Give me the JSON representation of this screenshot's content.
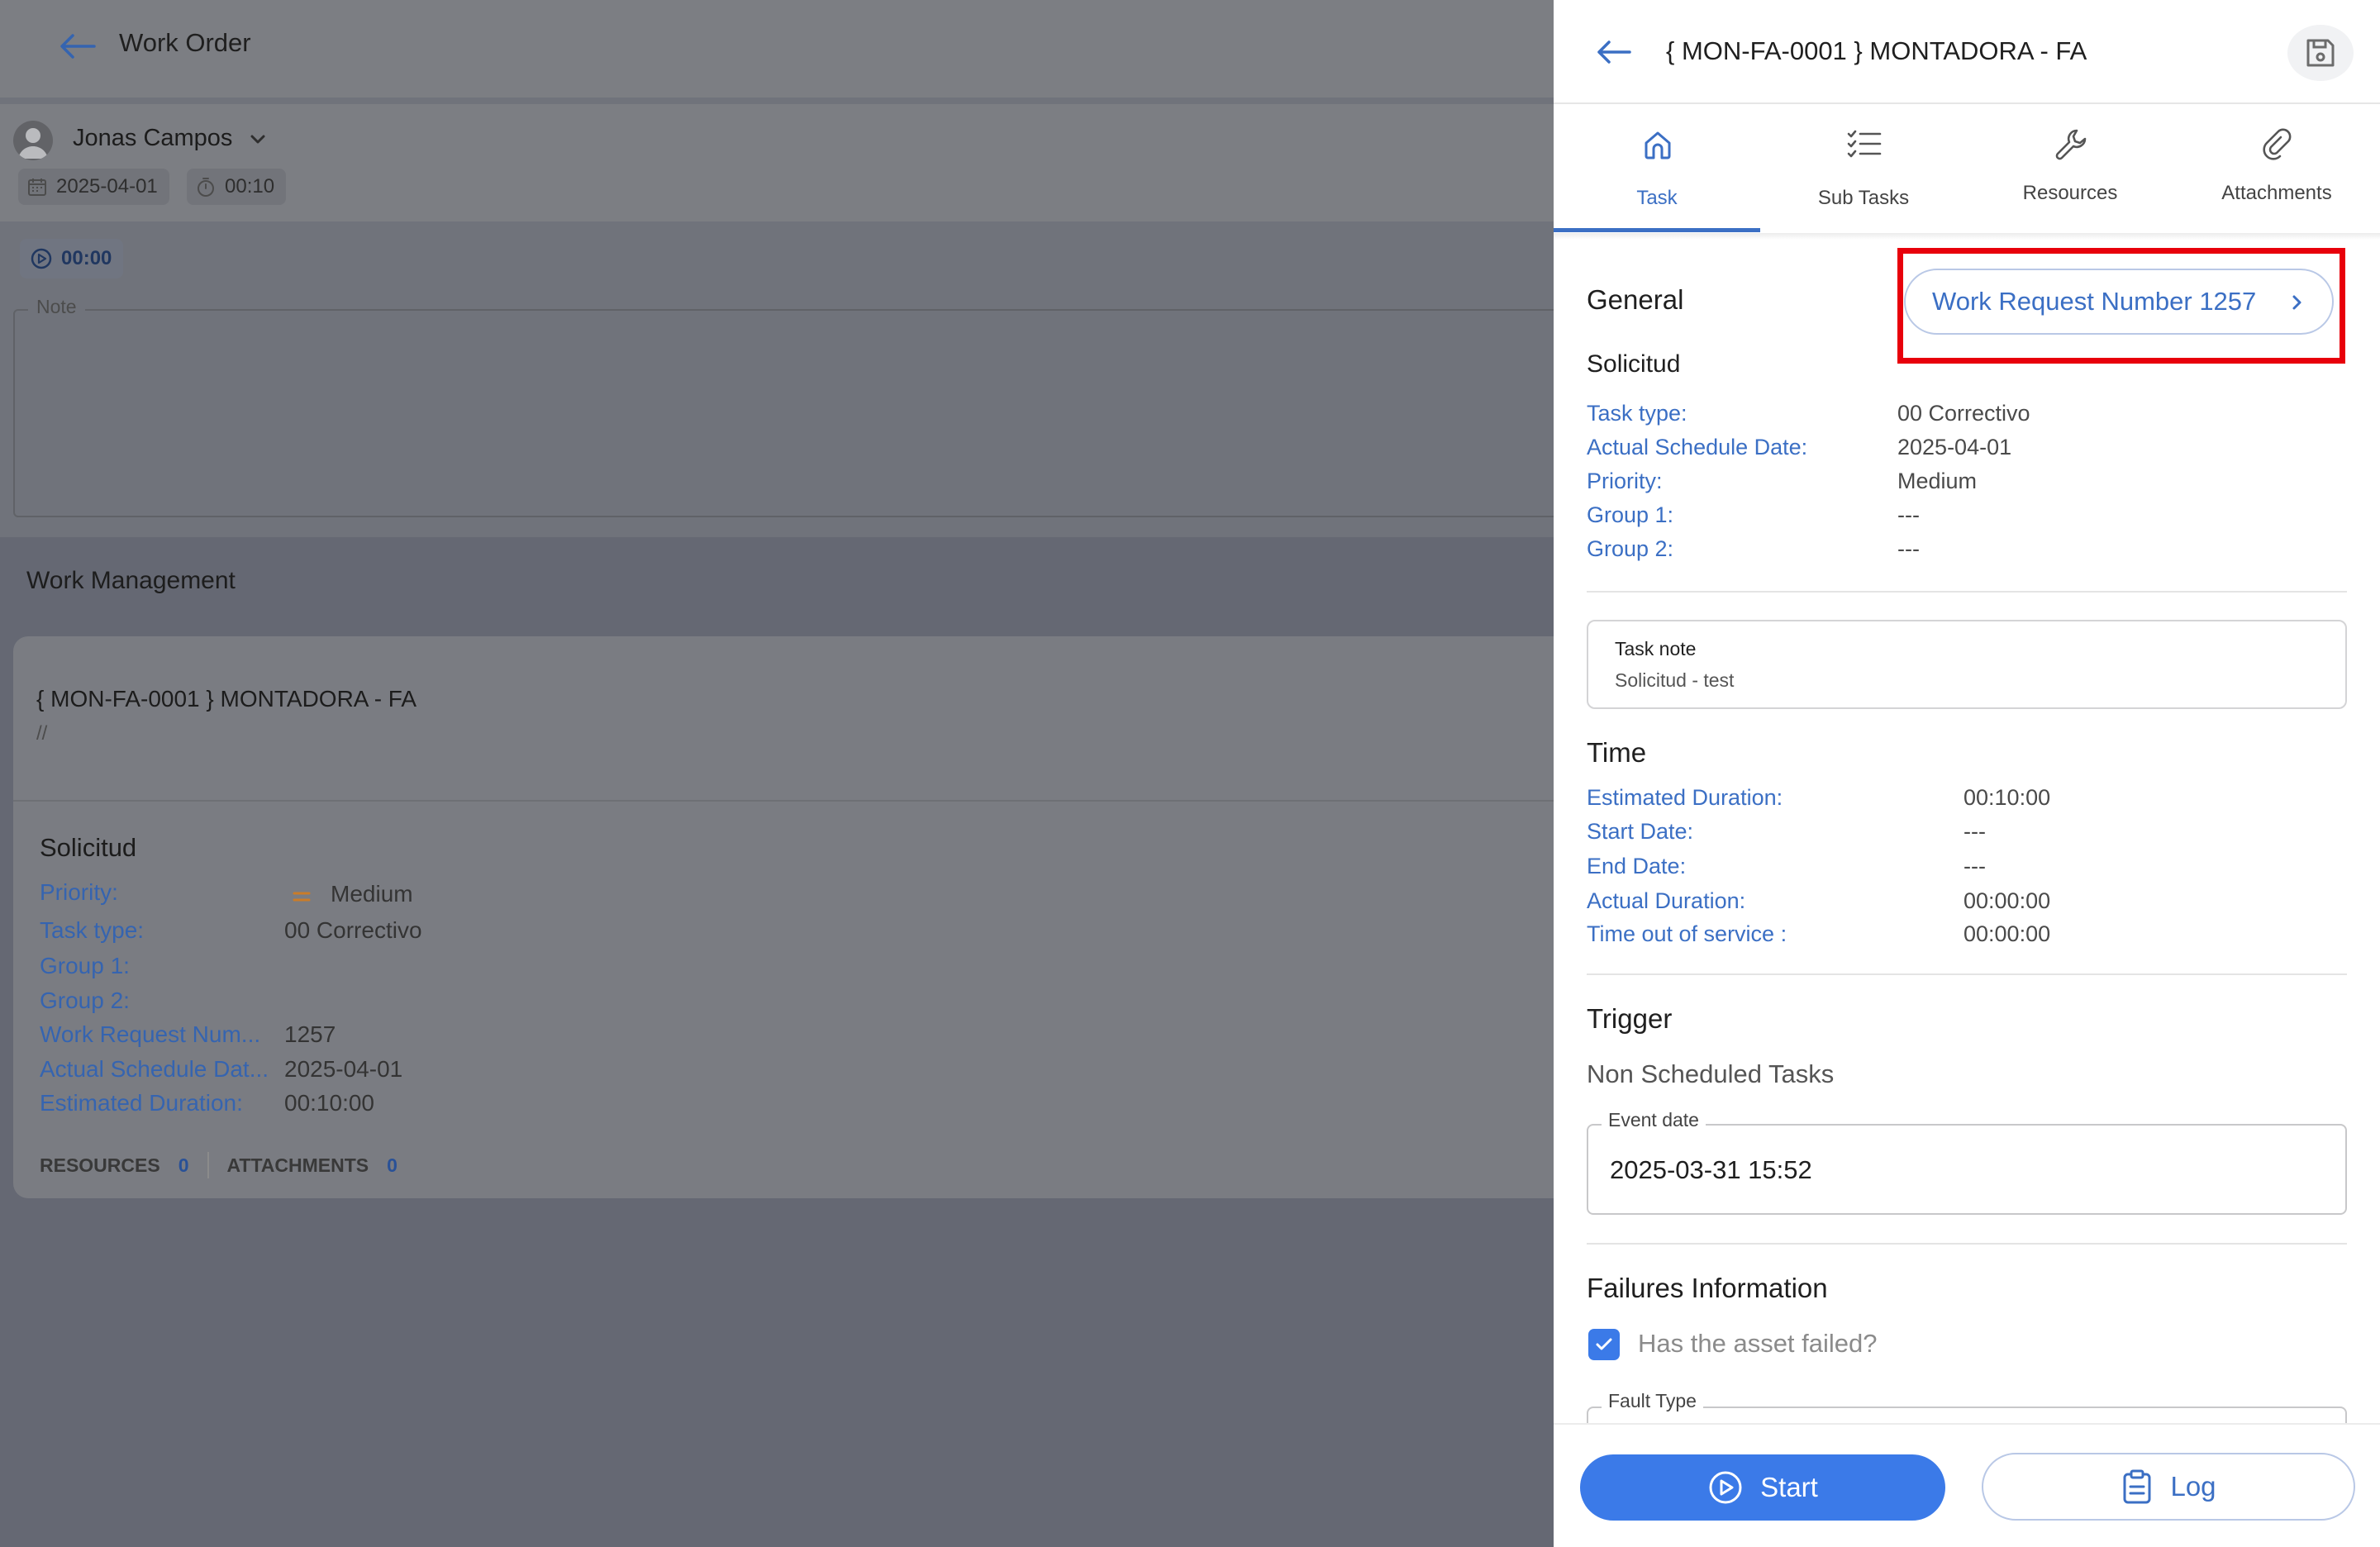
{
  "page": {
    "title": "Work Order",
    "user": {
      "name": "Jonas Campos"
    },
    "date": "2025-04-01",
    "timer": "00:10",
    "play_time": "00:00",
    "note_label": "Note"
  },
  "work_management": {
    "title": "Work Management",
    "card": {
      "asset": "{ MON-FA-0001 } MONTADORA - FA",
      "path": "//",
      "section": "Solicitud",
      "rows": [
        {
          "label": "Priority:",
          "value": "Medium"
        },
        {
          "label": "Task type:",
          "value": "00 Correctivo"
        },
        {
          "label": "Group 1:",
          "value": ""
        },
        {
          "label": "Group 2:",
          "value": ""
        },
        {
          "label": "Work Request Num...",
          "value": "1257"
        },
        {
          "label": "Actual Schedule Dat...",
          "value": "2025-04-01"
        },
        {
          "label": "Estimated Duration:",
          "value": "00:10:00"
        }
      ],
      "resources_label": "RESOURCES",
      "resources_count": "0",
      "attachments_label": "ATTACHMENTS",
      "attachments_count": "0"
    }
  },
  "drawer": {
    "title": "{ MON-FA-0001 } MONTADORA - FA",
    "tabs": [
      {
        "label": "Task",
        "icon": "home-icon",
        "active": true
      },
      {
        "label": "Sub Tasks",
        "icon": "checklist-icon",
        "active": false
      },
      {
        "label": "Resources",
        "icon": "wrench-icon",
        "active": false
      },
      {
        "label": "Attachments",
        "icon": "paperclip-icon",
        "active": false
      }
    ],
    "general": {
      "title": "General",
      "work_request_button": "Work Request Number 1257",
      "section": "Solicitud",
      "rows": [
        {
          "label": "Task type:",
          "value": "00 Correctivo"
        },
        {
          "label": "Actual Schedule Date:",
          "value": "2025-04-01"
        },
        {
          "label": "Priority:",
          "value": "Medium"
        },
        {
          "label": "Group 1:",
          "value": "---"
        },
        {
          "label": "Group 2:",
          "value": "---"
        }
      ],
      "task_note_label": "Task note",
      "task_note_value": "Solicitud - test"
    },
    "time": {
      "title": "Time",
      "rows": [
        {
          "label": "Estimated Duration:",
          "value": "00:10:00"
        },
        {
          "label": "Start Date:",
          "value": "---"
        },
        {
          "label": "End Date:",
          "value": "---"
        },
        {
          "label": "Actual Duration:",
          "value": "00:00:00"
        },
        {
          "label": "Time out of service :",
          "value": "00:00:00"
        }
      ]
    },
    "trigger": {
      "title": "Trigger",
      "subtitle": "Non Scheduled Tasks",
      "event_date_label": "Event date",
      "event_date_value": "2025-03-31 15:52"
    },
    "failures": {
      "title": "Failures Information",
      "asset_failed_label": "Has the asset failed?",
      "asset_failed_checked": true,
      "fault_type_label": "Fault Type"
    },
    "footer": {
      "start_label": "Start",
      "log_label": "Log"
    }
  },
  "colors": {
    "accent": "#3b7ae8",
    "link_text": "#3b6fc4",
    "highlight": "#e8000b",
    "priority_medium": "#e08a2c"
  }
}
